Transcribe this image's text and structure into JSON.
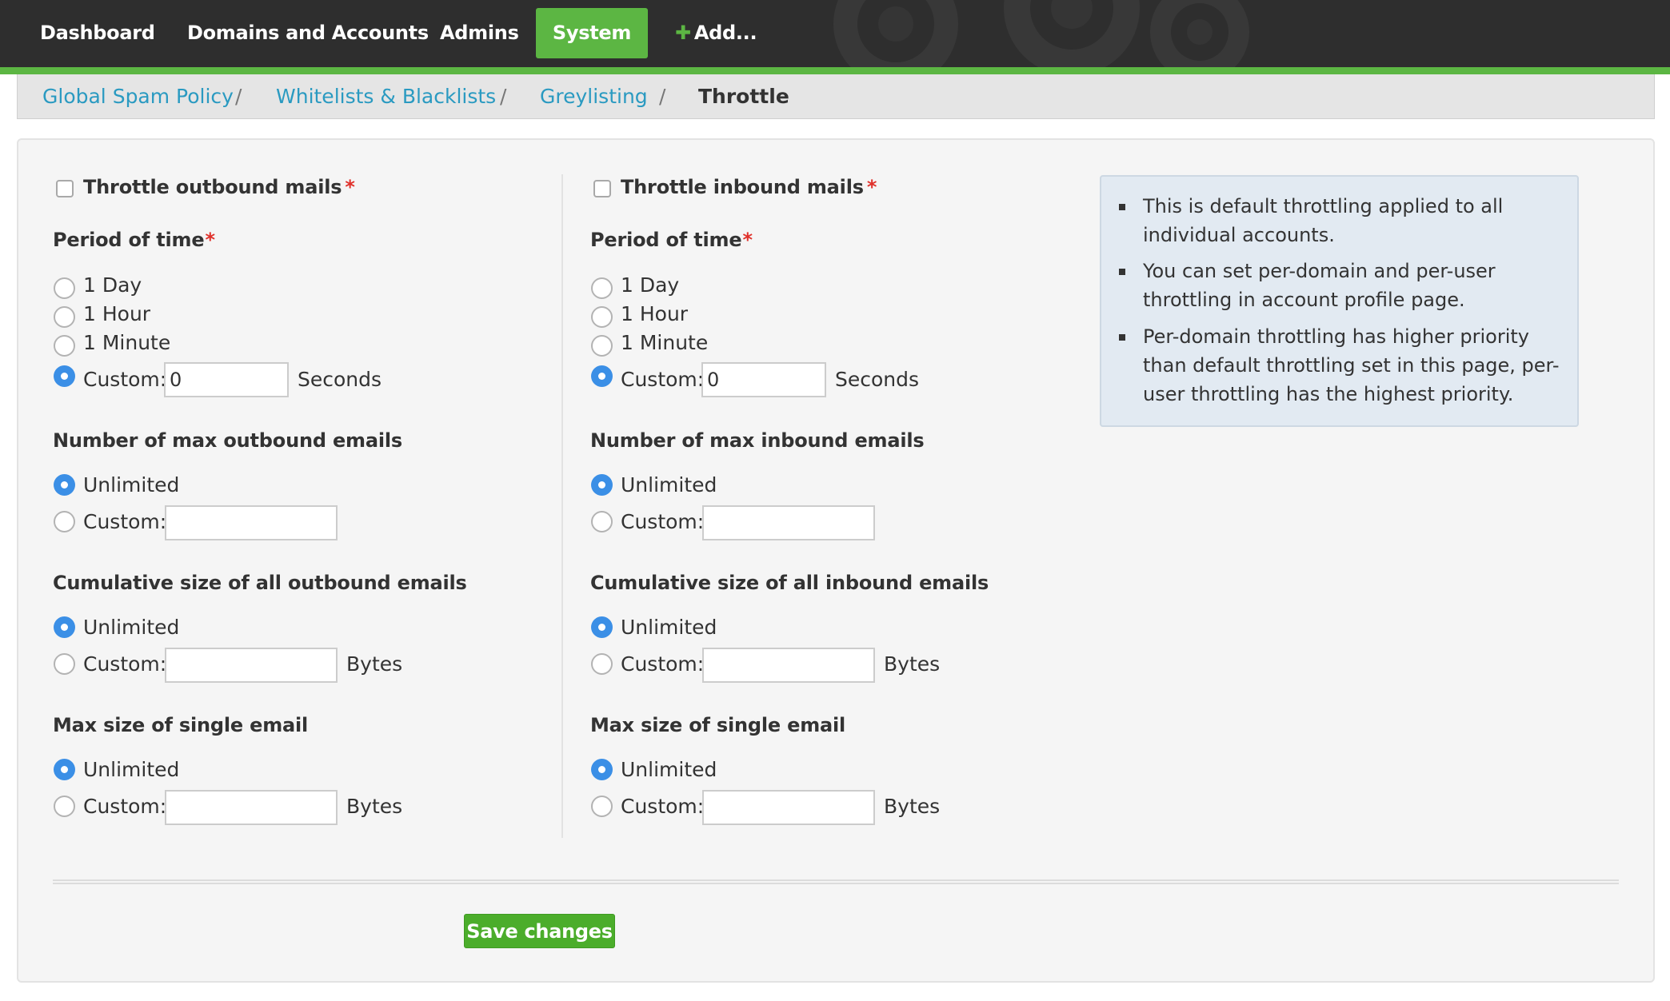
{
  "nav": {
    "items": [
      "Dashboard",
      "Domains and Accounts",
      "Admins",
      "System",
      "Add..."
    ],
    "active": "System"
  },
  "breadcrumb": {
    "items": [
      "Global Spam Policy",
      "Whitelists & Blacklists",
      "Greylisting",
      "Throttle"
    ],
    "separator": "/"
  },
  "outbound": {
    "enable_label": "Throttle outbound mails",
    "required_mark": "*",
    "period": {
      "label": "Period of time",
      "options": [
        "1 Day",
        "1 Hour",
        "1 Minute"
      ],
      "custom_label": "Custom:",
      "custom_value": "0",
      "unit": "Seconds",
      "selected": "Custom"
    },
    "max_emails": {
      "label": "Number of max outbound emails",
      "unlimited_label": "Unlimited",
      "custom_label": "Custom:",
      "custom_value": "",
      "selected": "Unlimited"
    },
    "cumulative_size": {
      "label": "Cumulative size of all outbound emails",
      "unlimited_label": "Unlimited",
      "custom_label": "Custom:",
      "custom_value": "",
      "unit": "Bytes",
      "selected": "Unlimited"
    },
    "max_single": {
      "label": "Max size of single email",
      "unlimited_label": "Unlimited",
      "custom_label": "Custom:",
      "custom_value": "",
      "unit": "Bytes",
      "selected": "Unlimited"
    }
  },
  "inbound": {
    "enable_label": "Throttle inbound mails",
    "required_mark": "*",
    "period": {
      "label": "Period of time",
      "options": [
        "1 Day",
        "1 Hour",
        "1 Minute"
      ],
      "custom_label": "Custom:",
      "custom_value": "0",
      "unit": "Seconds",
      "selected": "Custom"
    },
    "max_emails": {
      "label": "Number of max inbound emails",
      "unlimited_label": "Unlimited",
      "custom_label": "Custom:",
      "custom_value": "",
      "selected": "Unlimited"
    },
    "cumulative_size": {
      "label": "Cumulative size of all inbound emails",
      "unlimited_label": "Unlimited",
      "custom_label": "Custom:",
      "custom_value": "",
      "unit": "Bytes",
      "selected": "Unlimited"
    },
    "max_single": {
      "label": "Max size of single email",
      "unlimited_label": "Unlimited",
      "custom_label": "Custom:",
      "custom_value": "",
      "unit": "Bytes",
      "selected": "Unlimited"
    }
  },
  "info": {
    "items": [
      "This is default throttling applied to all individual accounts.",
      "You can set per-domain and per-user throttling in account profile page.",
      "Per-domain throttling has higher priority than default throttling set in this page, per-user throttling has the highest priority."
    ]
  },
  "save_label": "Save changes",
  "colors": {
    "nav_bg": "#2e2e2e",
    "accent_green": "#5cb643",
    "link_blue": "#2a9ac1",
    "radio_blue": "#3b8fe6",
    "required_red": "#e0312b",
    "info_bg": "#e2eaf2"
  }
}
